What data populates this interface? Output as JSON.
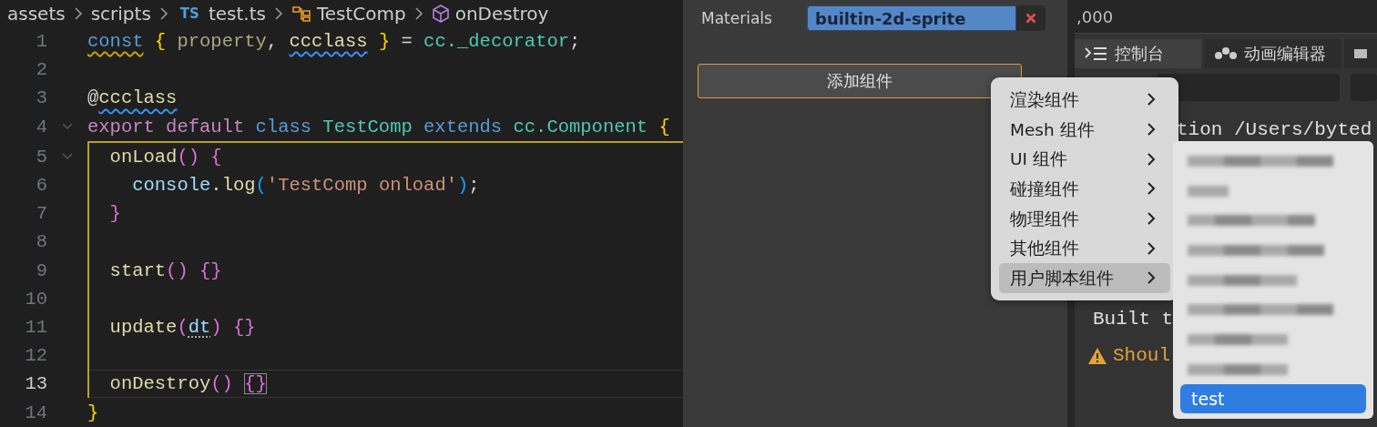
{
  "breadcrumb": [
    {
      "label": "assets",
      "kind": "folder"
    },
    {
      "label": "scripts",
      "kind": "folder"
    },
    {
      "label": "test.ts",
      "kind": "file",
      "badge": "TS"
    },
    {
      "label": "TestComp",
      "kind": "class"
    },
    {
      "label": "onDestroy",
      "kind": "method"
    }
  ],
  "code": [
    {
      "kind": "plain",
      "lines": [
        {
          "number": "1",
          "tokens": [
            {
              "text": "const",
              "kind": "keyword",
              "squiggle": {
                "kind": "warning"
              }
            },
            {
              "text": " { ",
              "kind": "brace1"
            },
            {
              "text": "property",
              "kind": "unused"
            },
            {
              "text": ", ",
              "kind": "punct"
            },
            {
              "text": "ccclass",
              "kind": "func",
              "squiggle": {
                "kind": "info"
              }
            },
            {
              "text": " } ",
              "kind": "brace1"
            },
            {
              "text": "= ",
              "kind": "punct"
            },
            {
              "text": "cc._decorator",
              "kind": "type"
            },
            {
              "text": ";",
              "kind": "punct"
            }
          ]
        },
        {
          "number": "2"
        },
        {
          "number": "3",
          "tokens": [
            {
              "text": "@",
              "kind": "punct"
            },
            {
              "text": "ccclass",
              "kind": "func",
              "squiggle": {
                "kind": "info"
              }
            }
          ]
        },
        {
          "number": "4",
          "fold": true,
          "tokens": [
            {
              "text": "export default ",
              "kind": "keyword2"
            },
            {
              "text": "class ",
              "kind": "keyword"
            },
            {
              "text": "TestComp ",
              "kind": "type"
            },
            {
              "text": "extends ",
              "kind": "keyword"
            },
            {
              "text": "cc.Component ",
              "kind": "type"
            },
            {
              "text": "{",
              "kind": "brace1"
            }
          ]
        }
      ]
    },
    {
      "kind": "scope",
      "lines": [
        {
          "number": "5",
          "fold": true,
          "tokens": [
            {
              "text": "onLoad",
              "kind": "func"
            },
            {
              "text": "() {",
              "kind": "brace2"
            }
          ],
          "children": [
            {
              "number": "6",
              "tokens": [
                {
                  "text": "console",
                  "kind": "var"
                },
                {
                  "text": ".",
                  "kind": "punct"
                },
                {
                  "text": "log",
                  "kind": "func"
                },
                {
                  "text": "(",
                  "kind": "brace3"
                },
                {
                  "text": "'TestComp onload'",
                  "kind": "string"
                },
                {
                  "text": ")",
                  "kind": "brace3"
                },
                {
                  "text": ";",
                  "kind": "punct"
                }
              ]
            }
          ]
        },
        {
          "number": "7",
          "tokens": [
            {
              "text": "}",
              "kind": "brace2"
            }
          ]
        },
        {
          "number": "8"
        },
        {
          "number": "9",
          "tokens": [
            {
              "text": "start",
              "kind": "func"
            },
            {
              "text": "() {}",
              "kind": "brace2"
            }
          ]
        },
        {
          "number": "10"
        },
        {
          "number": "11",
          "tokens": [
            {
              "text": "update",
              "kind": "func"
            },
            {
              "text": "(",
              "kind": "brace2"
            },
            {
              "text": "dt",
              "kind": "param",
              "squiggle": {
                "kind": "hint"
              }
            },
            {
              "text": ") {}",
              "kind": "brace2"
            }
          ]
        },
        {
          "number": "12"
        },
        {
          "number": "13",
          "current": true,
          "tokens": [
            {
              "text": "onDestroy",
              "kind": "func"
            },
            {
              "text": "() ",
              "kind": "brace2"
            },
            {
              "text": "{}",
              "kind": "brace2",
              "matched": true
            }
          ]
        }
      ]
    },
    {
      "kind": "plain",
      "lines": [
        {
          "number": "14",
          "tokens": [
            {
              "text": "}",
              "kind": "brace1"
            }
          ]
        }
      ]
    }
  ],
  "inspector": {
    "materials_label": "Materials",
    "material": "builtin-2d-sprite",
    "add_button": "添加组件"
  },
  "console": {
    "ruler_value": ",000",
    "tabs": [
      {
        "label": "控制台",
        "kind": "console",
        "selected": true
      },
      {
        "label": "动画编辑器",
        "kind": "animation",
        "selected": false
      },
      {
        "kind": "more",
        "selected": false
      }
    ],
    "lines": [
      {
        "text": "tion /Users/byted",
        "kind": "log"
      },
      {
        "text": "Built t",
        "kind": "log"
      },
      {
        "text": "Shoul",
        "kind": "warning"
      }
    ]
  },
  "menu": [
    {
      "label": "渲染组件",
      "selected": false
    },
    {
      "label": "Mesh 组件",
      "selected": false
    },
    {
      "label": "UI 组件",
      "selected": false
    },
    {
      "label": "碰撞组件",
      "selected": false
    },
    {
      "label": "物理组件",
      "selected": false
    },
    {
      "label": "其他组件",
      "selected": false
    },
    {
      "label": "用户脚本组件",
      "selected": true
    }
  ],
  "submenu": [
    {
      "kind": "blurred",
      "selected": false
    },
    {
      "kind": "blurred",
      "selected": false
    },
    {
      "kind": "blurred",
      "selected": false
    },
    {
      "kind": "blurred",
      "selected": false
    },
    {
      "kind": "blurred",
      "selected": false
    },
    {
      "kind": "blurred",
      "selected": false
    },
    {
      "kind": "blurred",
      "selected": false
    },
    {
      "kind": "blurred",
      "selected": false
    },
    {
      "kind": "item",
      "label": "test",
      "selected": true
    }
  ]
}
